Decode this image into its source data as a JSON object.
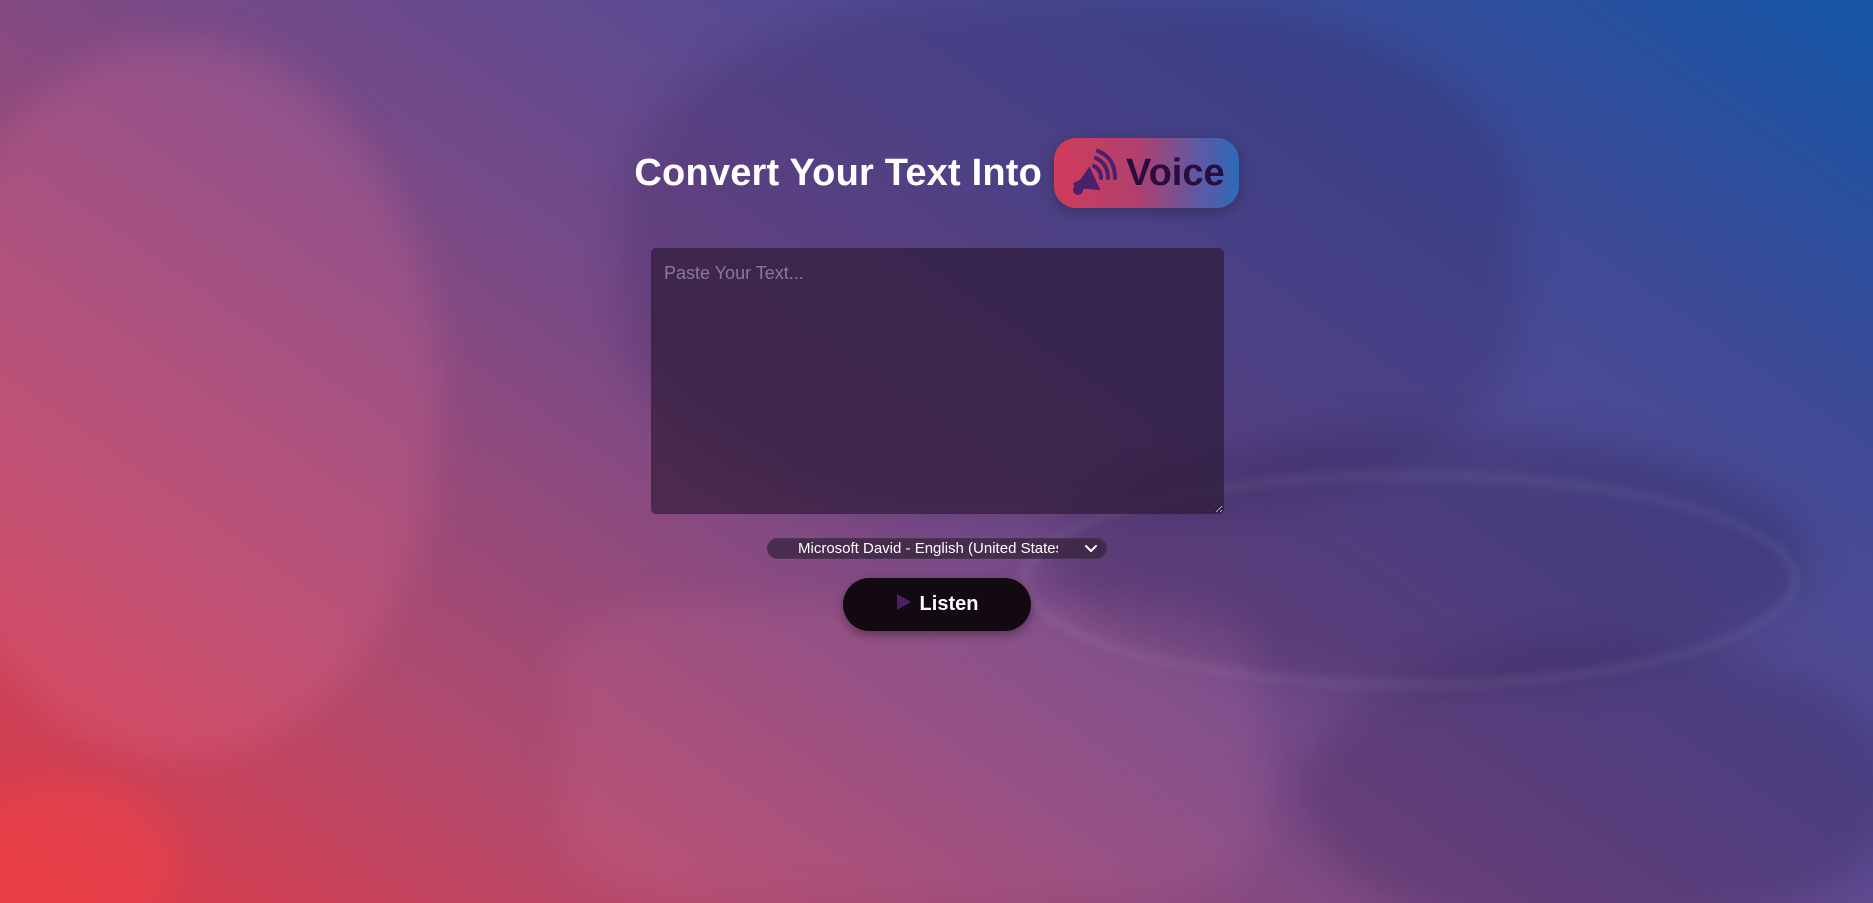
{
  "header": {
    "title": "Convert Your Text Into",
    "highlight": "Voice",
    "highlight_icon": "speaker-icon"
  },
  "input": {
    "placeholder": "Paste Your Text...",
    "value": ""
  },
  "voice_select": {
    "selected": "Microsoft David - English (United States)"
  },
  "listen_button": {
    "label": "Listen",
    "icon": "play-icon"
  },
  "colors": {
    "accent_red": "#e23a44",
    "accent_blue": "#1456a6",
    "play_icon": "#4b1f6b",
    "button_bg": "#120a10"
  }
}
